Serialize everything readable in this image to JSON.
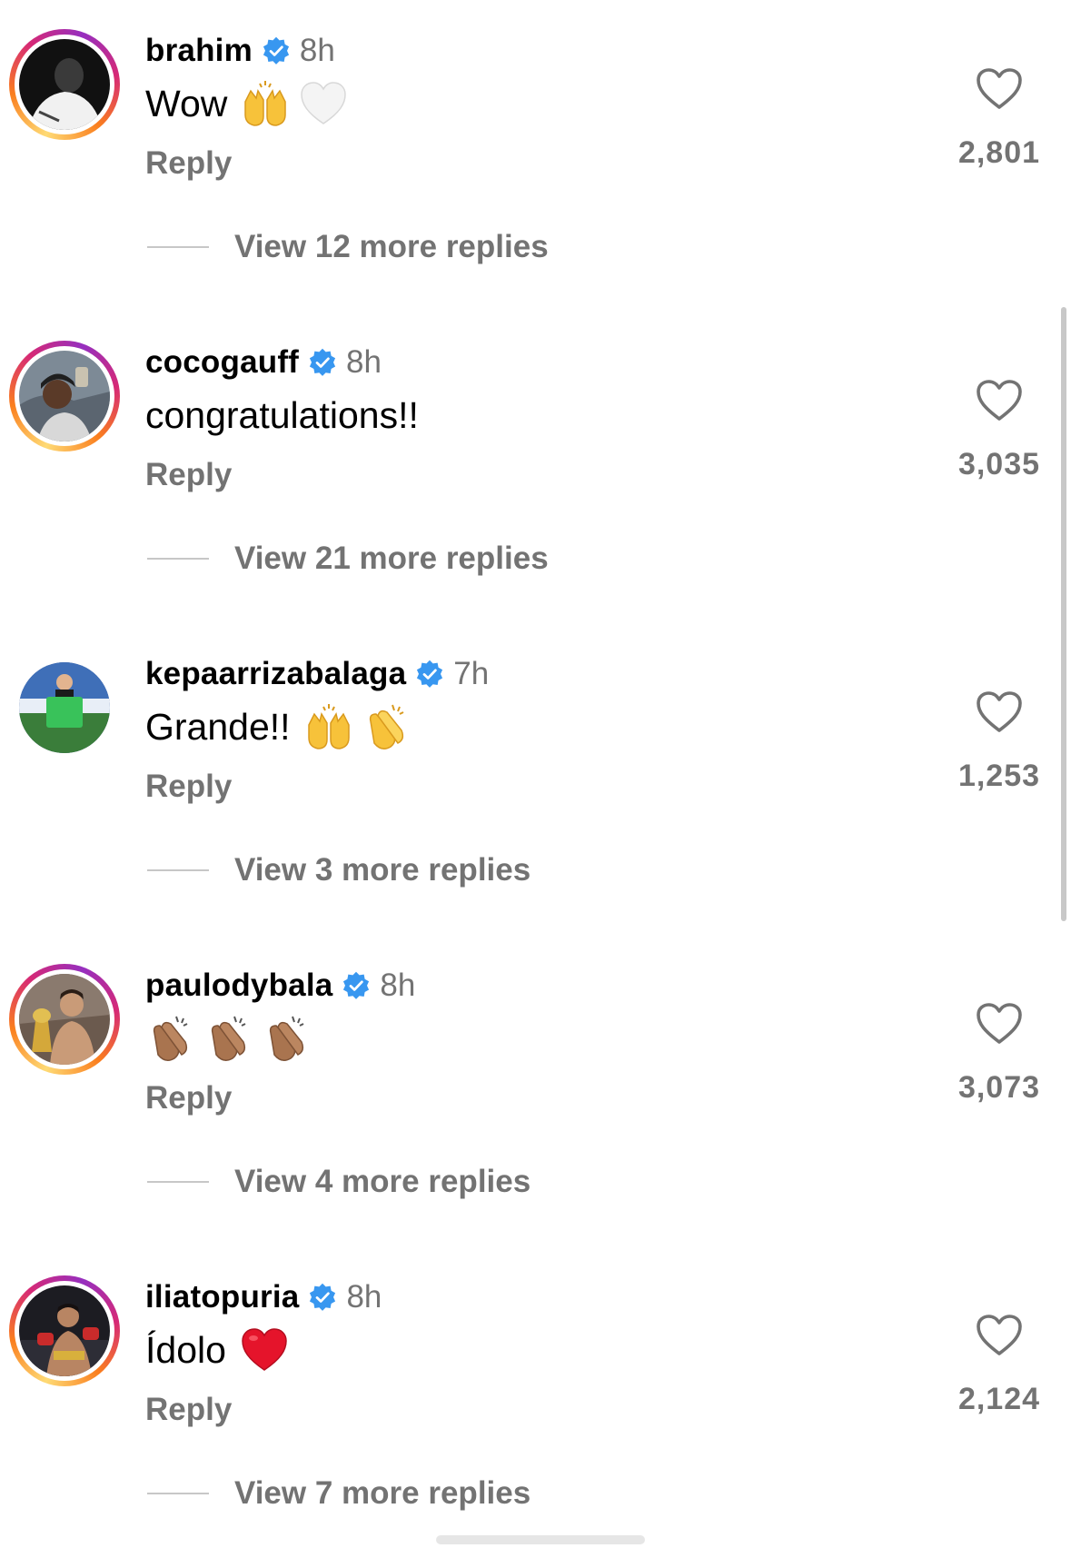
{
  "colors": {
    "muted": "#737373",
    "verified": "#3897f0",
    "divider": "#c7c7c7",
    "like_icon": "#737373"
  },
  "comments": [
    {
      "username": "brahim",
      "time": "8h",
      "text": "Wow",
      "emojis": [
        "raising-hands-emoji",
        "white-heart-emoji"
      ],
      "reply_label": "Reply",
      "view_replies": "View 12 more replies",
      "likes": "2,801",
      "avatar": "avatar-brahim",
      "story_ring": true
    },
    {
      "username": "cocogauff",
      "time": "8h",
      "text": "congratulations!!",
      "emojis": [],
      "reply_label": "Reply",
      "view_replies": "View 21 more replies",
      "likes": "3,035",
      "avatar": "avatar-cocogauff",
      "story_ring": true
    },
    {
      "username": "kepaarrizabalaga",
      "time": "7h",
      "text": "Grande!!",
      "emojis": [
        "raising-hands-emoji",
        "clapping-hands-emoji"
      ],
      "reply_label": "Reply",
      "view_replies": "View 3 more replies",
      "likes": "1,253",
      "avatar": "avatar-kepaarrizabalaga",
      "story_ring": false
    },
    {
      "username": "paulodybala",
      "time": "8h",
      "text": "",
      "emojis": [
        "clapping-hands-dark-emoji",
        "clapping-hands-dark-emoji",
        "clapping-hands-dark-emoji"
      ],
      "reply_label": "Reply",
      "view_replies": "View 4 more replies",
      "likes": "3,073",
      "avatar": "avatar-paulodybala",
      "story_ring": true
    },
    {
      "username": "iliatopuria",
      "time": "8h",
      "text": "Ídolo",
      "emojis": [
        "red-heart-emoji"
      ],
      "reply_label": "Reply",
      "view_replies": "View 7 more replies",
      "likes": "2,124",
      "avatar": "avatar-iliatopuria",
      "story_ring": true
    }
  ]
}
